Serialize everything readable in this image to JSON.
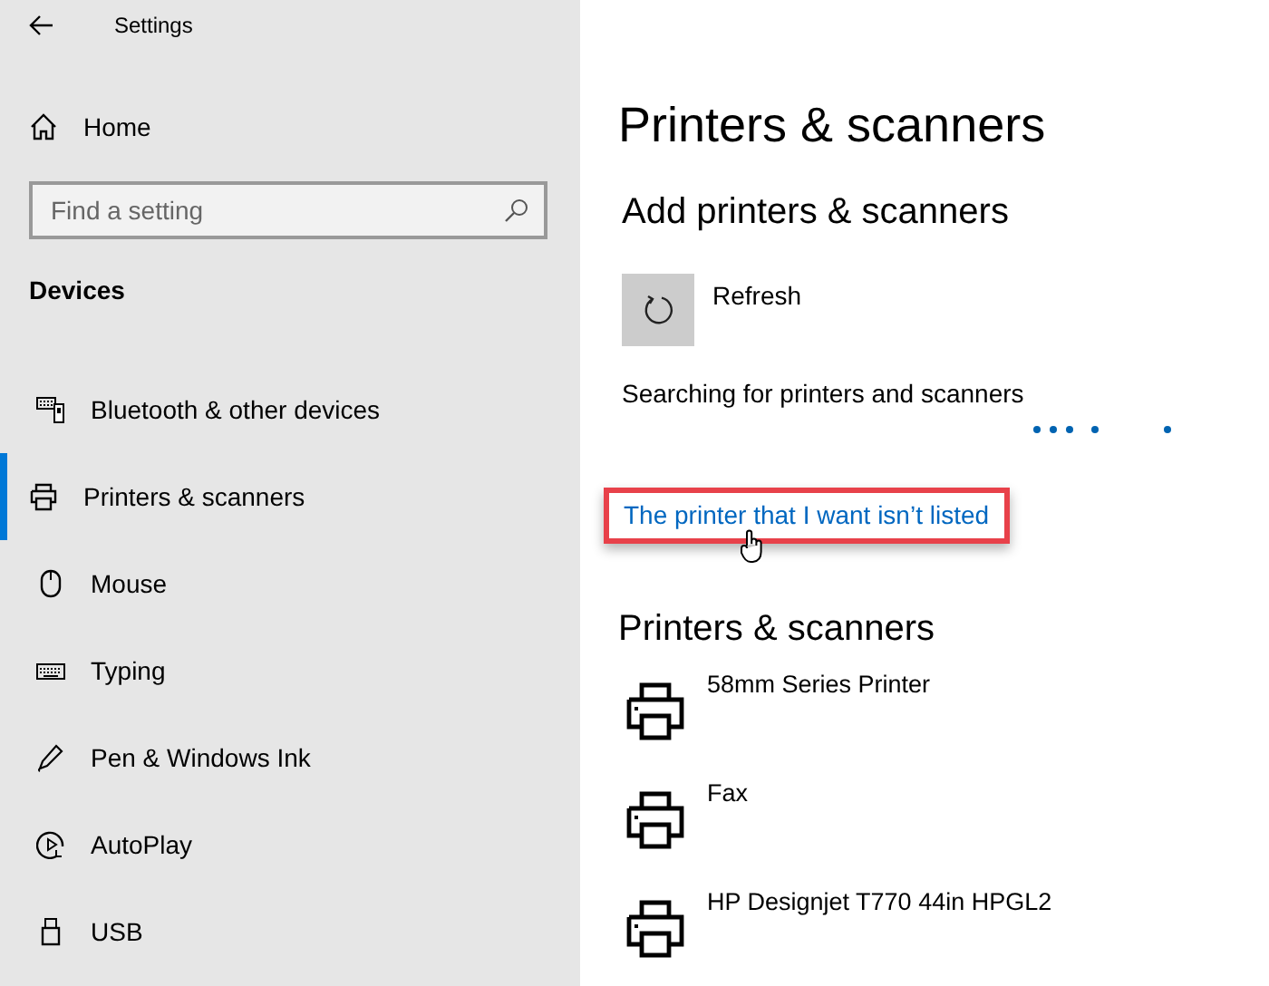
{
  "window": {
    "title": "Settings"
  },
  "sidebar": {
    "home": "Home",
    "search": {
      "placeholder": "Find a setting"
    },
    "section": "Devices",
    "items": [
      {
        "label": "Bluetooth & other devices",
        "kind": "devices",
        "selected": false
      },
      {
        "label": "Printers & scanners",
        "kind": "printer",
        "selected": true
      },
      {
        "label": "Mouse",
        "kind": "mouse",
        "selected": false
      },
      {
        "label": "Typing",
        "kind": "keyboard",
        "selected": false
      },
      {
        "label": "Pen & Windows Ink",
        "kind": "pen",
        "selected": false
      },
      {
        "label": "AutoPlay",
        "kind": "autoplay",
        "selected": false
      },
      {
        "label": "USB",
        "kind": "usb",
        "selected": false
      }
    ]
  },
  "main": {
    "title": "Printers & scanners",
    "add_heading": "Add printers & scanners",
    "refresh": "Refresh",
    "status": "Searching for printers and scanners",
    "link": "The printer that I want isn’t listed",
    "list_heading": "Printers & scanners",
    "printers": [
      {
        "name": "58mm Series Printer"
      },
      {
        "name": "Fax"
      },
      {
        "name": "HP Designjet T770 44in HPGL2"
      }
    ]
  }
}
